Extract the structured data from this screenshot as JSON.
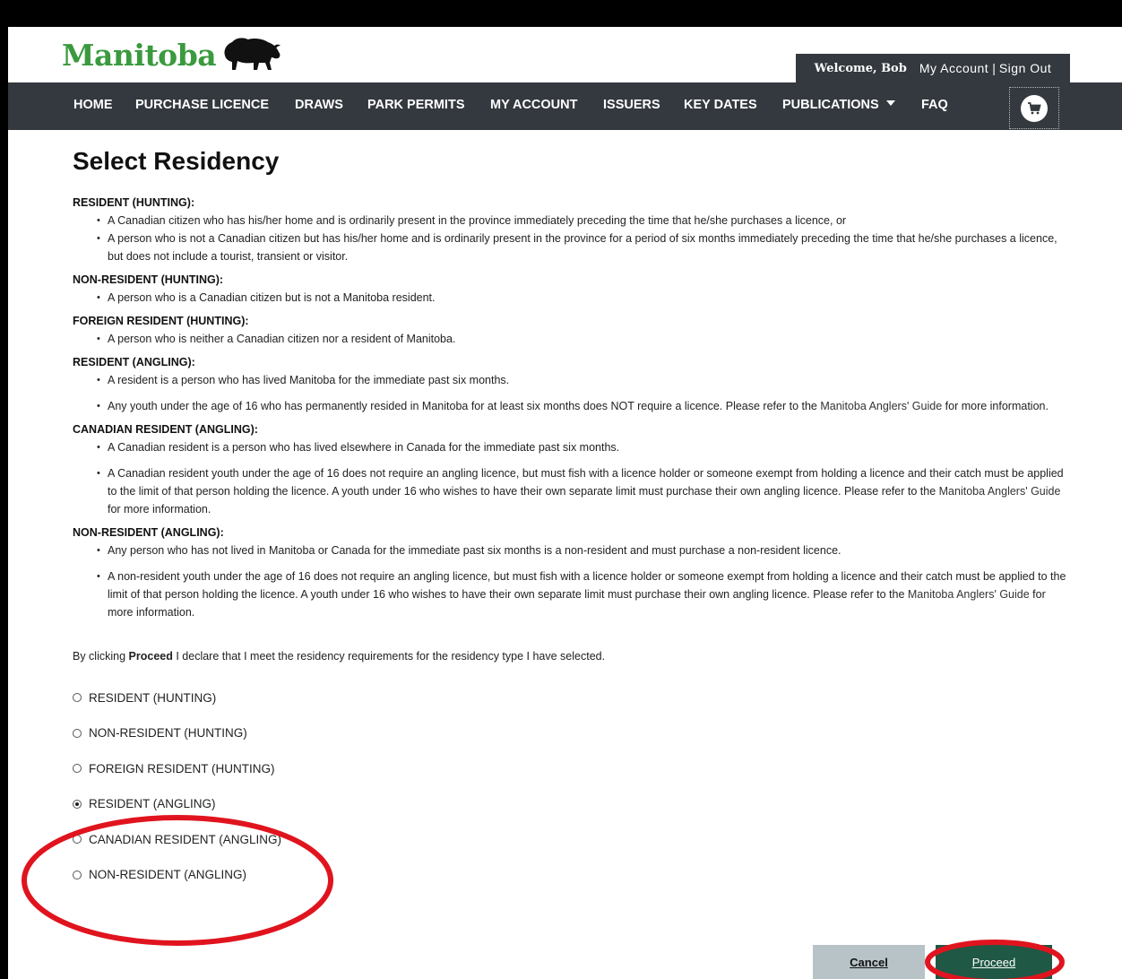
{
  "brand": {
    "name": "Manitoba"
  },
  "account": {
    "welcome": "Welcome, Bob",
    "my_account": "My Account",
    "separator": "|",
    "sign_out": "Sign Out"
  },
  "nav": {
    "items": [
      "HOME",
      "PURCHASE LICENCE",
      "DRAWS",
      "PARK PERMITS",
      "MY ACCOUNT",
      "ISSUERS",
      "KEY DATES",
      "PUBLICATIONS",
      "FAQ"
    ]
  },
  "page": {
    "title": "Select Residency",
    "sections": [
      {
        "title": "RESIDENT (HUNTING):",
        "bullets": [
          "A Canadian citizen who has his/her home and is ordinarily present in the province immediately preceding the time that he/she purchases a licence, or",
          "A person who is not a Canadian citizen but has his/her home and is ordinarily present in the province for a period of six months immediately preceding the time that he/she purchases a licence, but does not include a tourist, transient or visitor."
        ]
      },
      {
        "title": "NON-RESIDENT (HUNTING):",
        "bullets": [
          "A person who is a Canadian citizen but is not a Manitoba resident."
        ]
      },
      {
        "title": "FOREIGN RESIDENT (HUNTING):",
        "bullets": [
          "A person who is neither a Canadian citizen nor a resident of Manitoba."
        ]
      },
      {
        "title": "RESIDENT (ANGLING):",
        "bullets": [
          "A resident is a person who has lived Manitoba for the immediate past six months.",
          {
            "before": "Any youth under the age of 16 who has permanently resided in Manitoba for at least six months does NOT require a licence. Please refer to the ",
            "link": "Manitoba Anglers' Guide",
            "after": " for more information."
          }
        ]
      },
      {
        "title": "CANADIAN RESIDENT (ANGLING):",
        "bullets": [
          "A Canadian resident is a person who has lived elsewhere in Canada for the immediate past six months.",
          {
            "before": "A Canadian resident youth under the age of 16 does not require an angling licence, but must fish with a licence holder or someone exempt from holding a licence and their catch must be applied to the limit of that person holding the licence. A youth under 16 who wishes to have their own separate limit must purchase their own angling licence. Please refer to the ",
            "link": "Manitoba Anglers' Guide",
            "after": " for more information."
          }
        ]
      },
      {
        "title": "NON-RESIDENT (ANGLING):",
        "bullets": [
          "Any person who has not lived in Manitoba or Canada for the immediate past six months is a non-resident and must purchase a non-resident licence.",
          {
            "before": "A non-resident youth under the age of 16 does not require an angling licence, but must fish with a licence holder or someone exempt from holding a licence and their catch must be applied to the limit of that person holding the licence. A youth under 16 who wishes to have their own separate limit must purchase their own angling licence. Please refer to the ",
            "link": "Manitoba Anglers' Guide",
            "after": " for more information."
          }
        ]
      }
    ],
    "declaration": {
      "before": "By clicking ",
      "bold": "Proceed",
      "after": " I declare that I meet the residency requirements for the residency type I have selected."
    },
    "options": [
      "RESIDENT (HUNTING)",
      "NON-RESIDENT (HUNTING)",
      "FOREIGN RESIDENT (HUNTING)",
      "RESIDENT (ANGLING)",
      "CANADIAN RESIDENT (ANGLING)",
      "NON-RESIDENT (ANGLING)"
    ],
    "selected_option": "RESIDENT (ANGLING)",
    "buttons": {
      "cancel": "Cancel",
      "proceed": "Proceed"
    }
  },
  "colors": {
    "brand_green": "#3a9a3e",
    "nav_bg": "#33393e",
    "proceed_bg": "#1f5845",
    "cancel_bg": "#b8c3c8",
    "annotation_red": "#e0141e"
  }
}
